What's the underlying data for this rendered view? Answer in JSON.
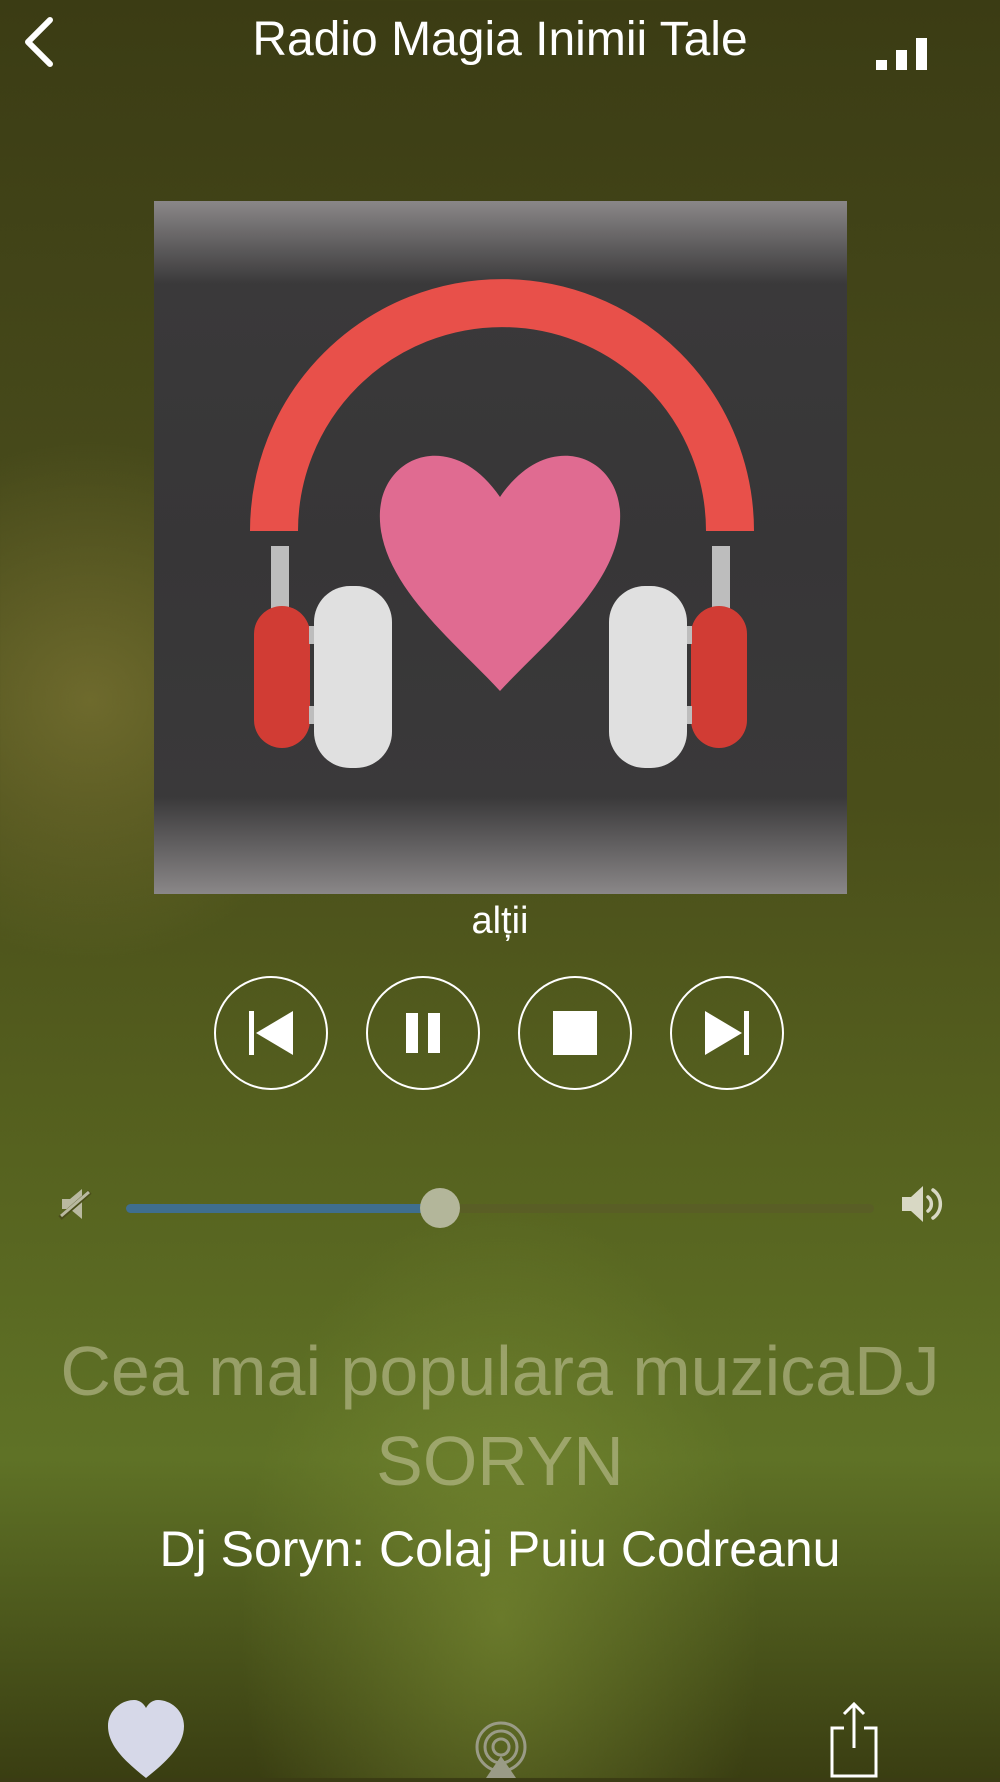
{
  "header": {
    "title": "Radio Magia Inimii Tale",
    "back_icon": "chevron-left-icon",
    "signal_icon": "signal-bars-icon"
  },
  "artwork": {
    "icon": "headphones-heart-icon"
  },
  "station_label": "alții",
  "controls": [
    {
      "name": "previous-button",
      "icon": "skip-previous-icon"
    },
    {
      "name": "pause-button",
      "icon": "pause-icon"
    },
    {
      "name": "stop-button",
      "icon": "stop-icon"
    },
    {
      "name": "next-button",
      "icon": "skip-next-icon"
    }
  ],
  "volume": {
    "level": 0.42,
    "low_icon": "volume-mute-icon",
    "high_icon": "volume-high-icon",
    "fill_color": "#3f6e8f"
  },
  "now_playing": {
    "title": "Cea mai populara muzicaDJ SORYN",
    "artist": "Dj Soryn: Colaj Puiu Codreanu"
  },
  "bottom_bar": {
    "favorite_icon": "heart-icon",
    "airplay_icon": "airplay-icon",
    "share_icon": "share-icon"
  }
}
